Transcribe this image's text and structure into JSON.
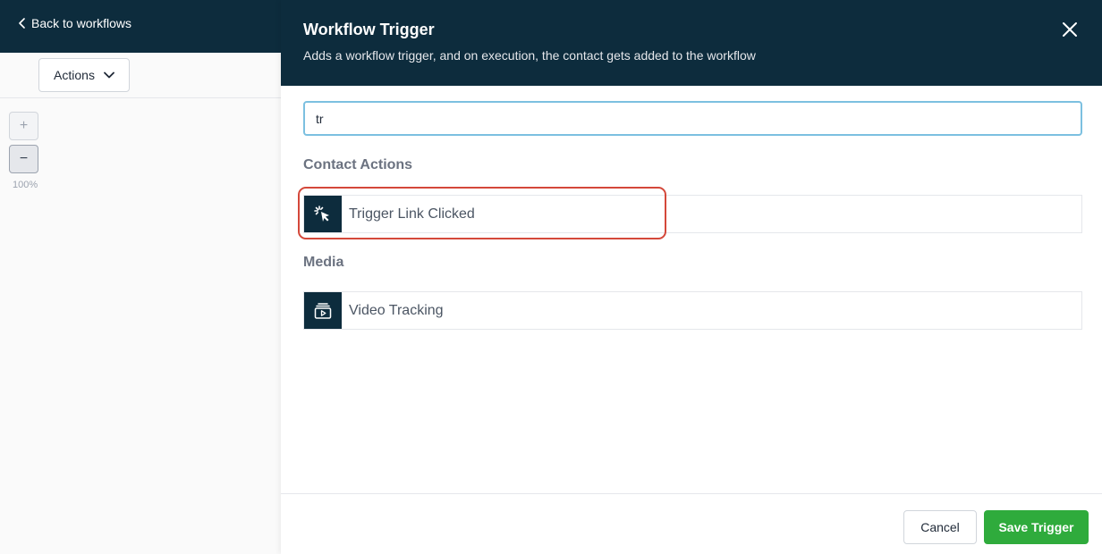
{
  "left_pane": {
    "back_label": "Back to workflows",
    "actions_label": "Actions",
    "zoom_in_label": "+",
    "zoom_out_label": "−",
    "zoom_level": "100%"
  },
  "drawer": {
    "title": "Workflow Trigger",
    "subtitle": "Adds a workflow trigger, and on execution, the contact gets added to the workflow",
    "search": {
      "value": "tr",
      "placeholder": ""
    },
    "sections": [
      {
        "label": "Contact Actions",
        "items": [
          {
            "label": "Trigger Link Clicked",
            "icon": "cursor-click-icon"
          }
        ]
      },
      {
        "label": "Media",
        "items": [
          {
            "label": "Video Tracking",
            "icon": "video-play-icon"
          }
        ]
      }
    ],
    "footer": {
      "cancel_label": "Cancel",
      "save_label": "Save Trigger"
    }
  },
  "colors": {
    "header_bg": "#0d2c3d",
    "accent_green": "#2fab3c",
    "highlight_red": "#d4483a",
    "focus_blue": "#7cc0e0"
  }
}
